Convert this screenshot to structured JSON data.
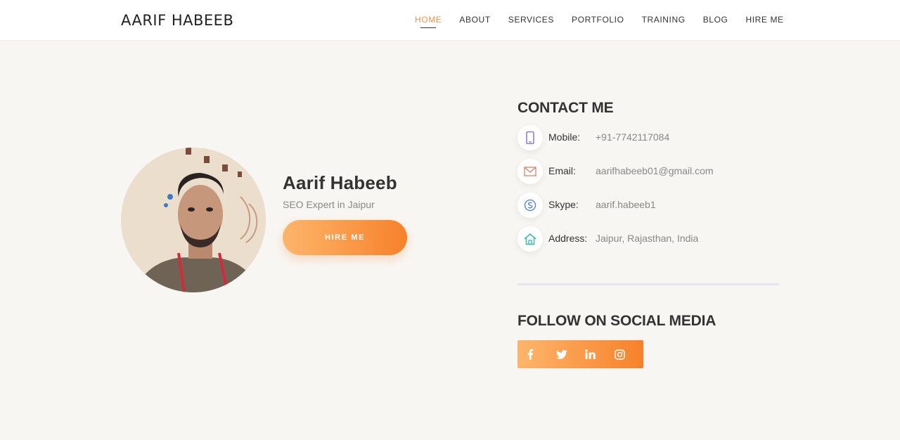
{
  "header": {
    "brand": "AARIF HABEEB",
    "nav": [
      "HOME",
      "ABOUT",
      "SERVICES",
      "PORTFOLIO",
      "TRAINING",
      "BLOG",
      "HIRE ME"
    ]
  },
  "profile": {
    "name": "Aarif Habeeb",
    "role": "SEO Expert in Jaipur",
    "hire_label": "HIRE ME"
  },
  "contact": {
    "title": "CONTACT ME",
    "items": [
      {
        "label": "Mobile:",
        "value": "+91-7742117084",
        "icon": "mobile-icon"
      },
      {
        "label": "Email:",
        "value": "aarifhabeeb01@gmail.com",
        "icon": "mail-icon"
      },
      {
        "label": "Skype:",
        "value": "aarif.habeeb1",
        "icon": "skype-icon"
      },
      {
        "label": "Address:",
        "value": "Jaipur, Rajasthan, India",
        "icon": "home-icon"
      }
    ]
  },
  "social": {
    "title": "FOLLOW ON SOCIAL MEDIA",
    "icons": [
      "facebook-icon",
      "twitter-icon",
      "linkedin-icon",
      "instagram-icon"
    ]
  },
  "colors": {
    "accent": "#f7812a",
    "accent_light": "#fdb56b",
    "background": "#f8f6f3"
  }
}
